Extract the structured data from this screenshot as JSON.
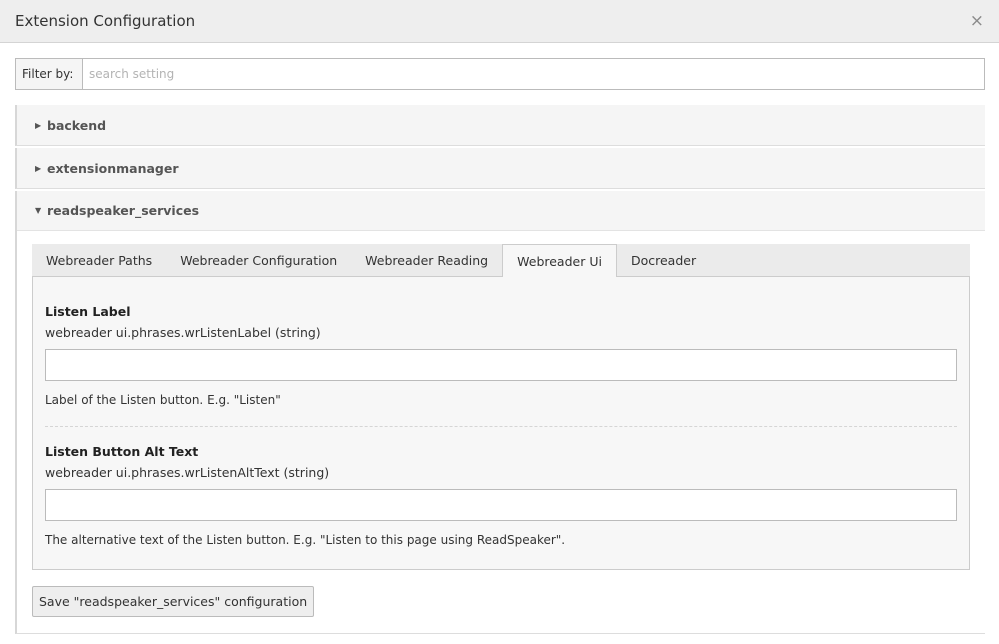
{
  "modal": {
    "title": "Extension Configuration",
    "close_symbol": "×"
  },
  "filter": {
    "label": "Filter by:",
    "placeholder": "search setting",
    "value": ""
  },
  "sections": [
    {
      "label": "backend",
      "expanded": false
    },
    {
      "label": "extensionmanager",
      "expanded": false
    },
    {
      "label": "readspeaker_services",
      "expanded": true
    }
  ],
  "icons": {
    "collapsed": "caret-right-icon",
    "expanded": "caret-down-icon",
    "close": "close-icon"
  },
  "tabs": [
    {
      "label": "Webreader Paths",
      "active": false
    },
    {
      "label": "Webreader Configuration",
      "active": false
    },
    {
      "label": "Webreader Reading",
      "active": false
    },
    {
      "label": "Webreader Ui",
      "active": true
    },
    {
      "label": "Docreader",
      "active": false
    }
  ],
  "settings": [
    {
      "title": "Listen Label",
      "key": "webreader ui.phrases.wrListenLabel (string)",
      "value": "",
      "description": "Label of the Listen button. E.g. \"Listen\""
    },
    {
      "title": "Listen Button Alt Text",
      "key": "webreader ui.phrases.wrListenAltText (string)",
      "value": "",
      "description": "The alternative text of the Listen button. E.g. \"Listen to this page using ReadSpeaker\"."
    }
  ],
  "save_button_label": "Save \"readspeaker_services\" configuration"
}
